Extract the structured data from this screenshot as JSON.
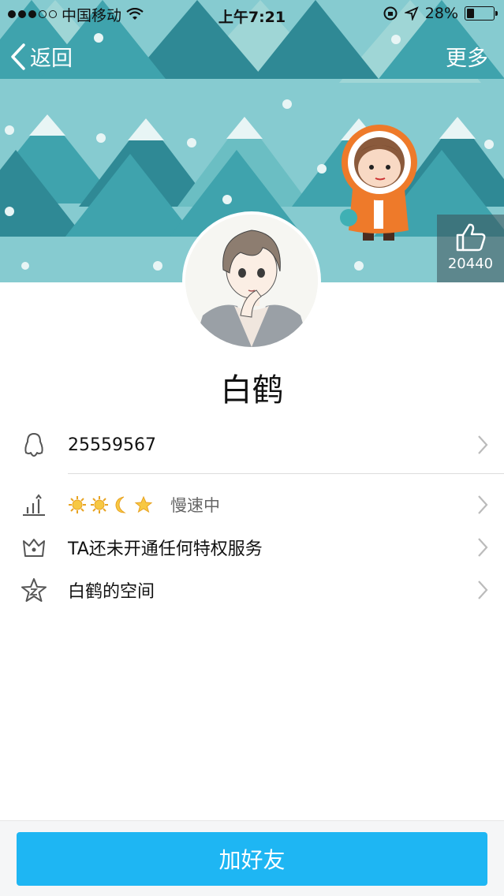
{
  "status_bar": {
    "carrier": "中国移动",
    "time": "上午7:21",
    "battery_text": "28%",
    "battery_level": 0.28
  },
  "nav": {
    "back_label": "返回",
    "more_label": "更多"
  },
  "likes": {
    "count": "20440"
  },
  "profile": {
    "name": "白鹤"
  },
  "rows": {
    "qq_number": "25559567",
    "level_status": "慢速中",
    "privilege": "TA还未开通任何特权服务",
    "space": "白鹤的空间"
  },
  "level_icons": [
    "sun-icon",
    "sun-icon",
    "moon-icon",
    "star-icon"
  ],
  "bottom": {
    "add_friend_label": "加好友"
  },
  "colors": {
    "sky": "#86cbd0",
    "tree_dark": "#2f8995",
    "tree_mid": "#3fa3ad",
    "tree_light": "#6bbec3",
    "snow": "#e8f5f5",
    "button": "#1eb6f3"
  }
}
